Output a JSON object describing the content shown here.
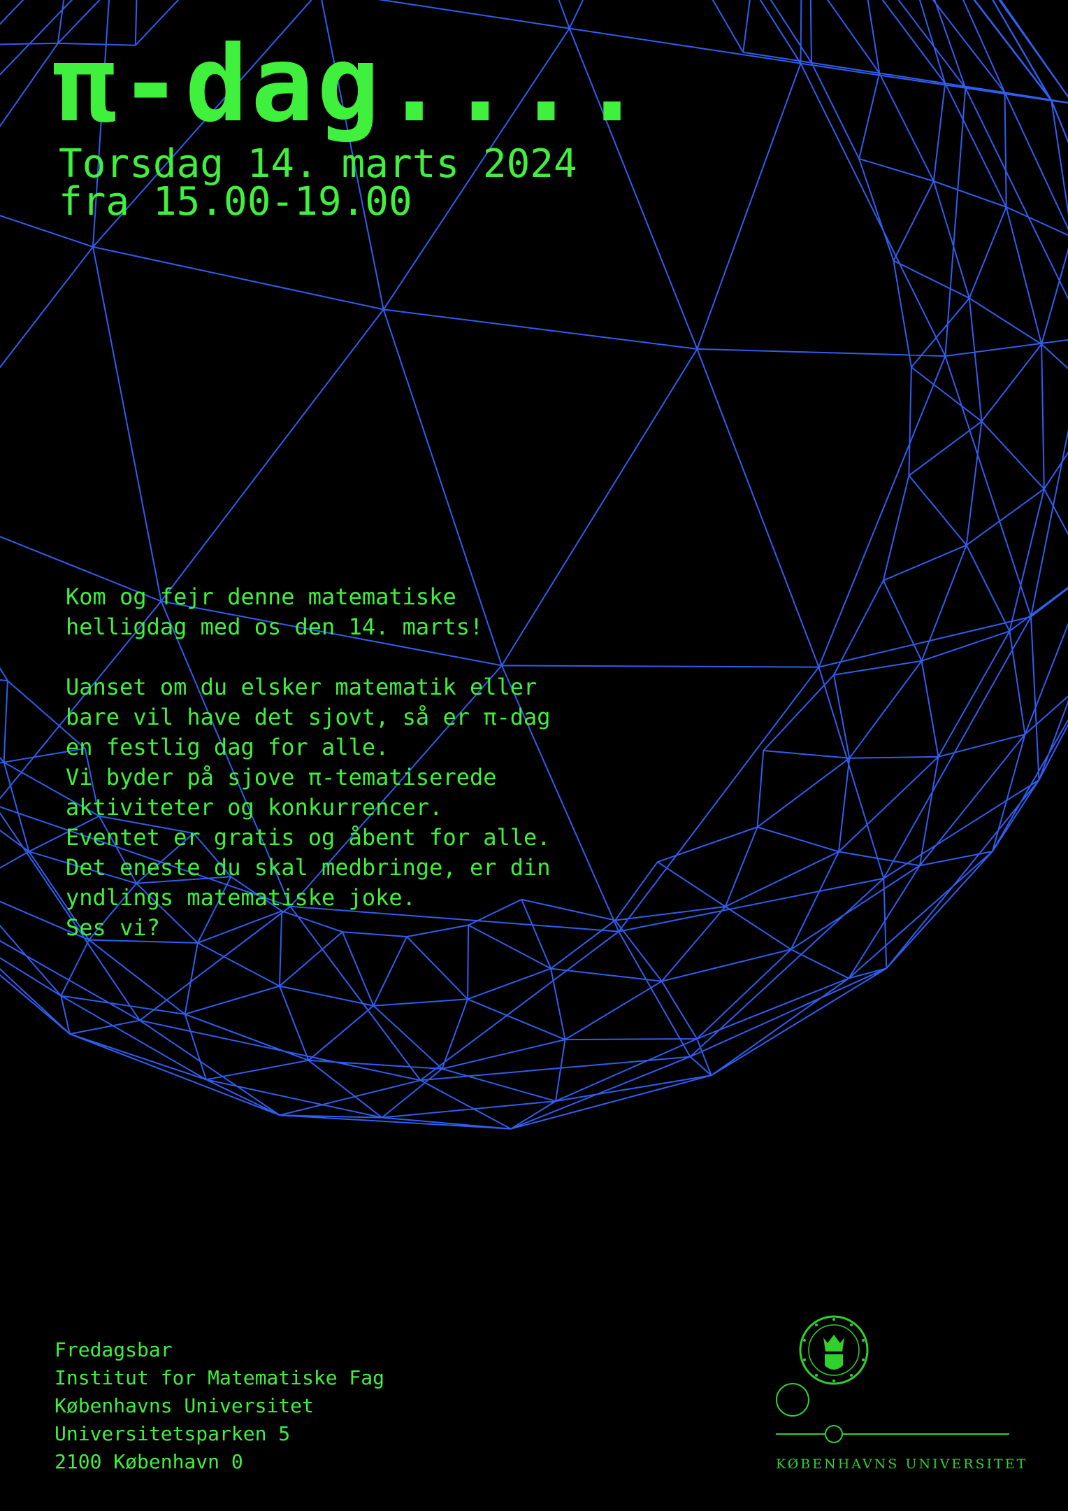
{
  "colors": {
    "background": "#000000",
    "text": "#3ff03c",
    "mesh": "#2f5ef0",
    "logo": "#2fd12c"
  },
  "title": "π-dag....",
  "date_lines": [
    "Torsdag 14. marts 2024",
    "fra 15.00-19.00"
  ],
  "intro_lines": [
    "Kom og fejr denne matematiske",
    "helligdag med os den 14. marts!"
  ],
  "body_lines": [
    "Uanset om du elsker matematik eller",
    "bare vil have det sjovt, så er π-dag",
    "en festlig dag for alle.",
    "Vi byder på sjove π-tematiserede",
    "aktiviteter og konkurrencer.",
    "Eventet er gratis og åbent for alle.",
    "Det eneste du skal medbringe, er din",
    "yndlings matematiske joke.",
    "Ses vi?"
  ],
  "footer_lines": [
    "Fredagsbar",
    "Institut for Matematiske Fag",
    "Københavns Universitet",
    "Universitetsparken 5",
    "2100 København 0"
  ],
  "logo": {
    "wordmark": "KØBENHAVNS UNIVERSITET",
    "icon": "university-seal-icon"
  }
}
